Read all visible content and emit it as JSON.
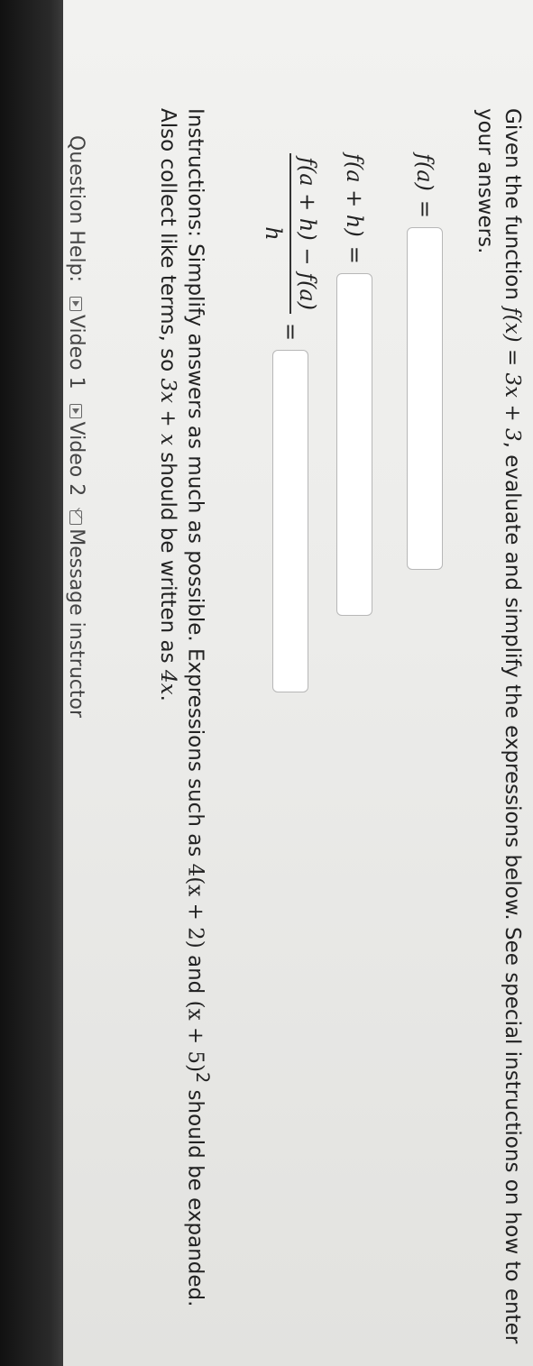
{
  "question": {
    "intro_prefix": "Given the function ",
    "function_expr": "f(x) = 3x + 3",
    "intro_suffix": ", evaluate and simplify the expressions below. See special instructions on how to enter your answers."
  },
  "parts": {
    "p1_label": "f(a)",
    "p2_label": "f(a + h)",
    "p3_numerator": "f(a + h) − f(a)",
    "p3_denominator": "h",
    "equals": "=",
    "p1_value": "",
    "p2_value": "",
    "p3_value": ""
  },
  "instructions": {
    "t1": "Instructions: Simplify answers as much as possible. Expressions such as ",
    "e1": "4(x + 2)",
    "t2": " and ",
    "e2": "(x + 5)",
    "e2_exp": "2",
    "t3": " should be expanded. Also collect like terms, so ",
    "e3": "3x + x",
    "t4": " should be written as ",
    "e4": "4x",
    "t5": "."
  },
  "help": {
    "label": "Question Help:",
    "video1": "Video 1",
    "video2": "Video 2",
    "message": "Message instructor"
  },
  "icons": {
    "video1": "video-play-icon",
    "video2": "video-play-icon",
    "message": "envelope-icon"
  }
}
